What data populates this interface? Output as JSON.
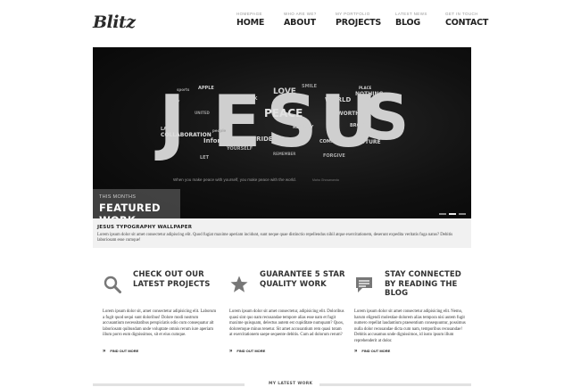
{
  "brand": {
    "logo": "Blitz"
  },
  "nav": [
    {
      "sub": "HOMEPAGE",
      "label": "HOME"
    },
    {
      "sub": "WHO ARE WE?",
      "label": "ABOUT"
    },
    {
      "sub": "MY PORTFOLIO",
      "label": "PROJECTS"
    },
    {
      "sub": "LATEST NEWS",
      "label": "BLOG"
    },
    {
      "sub": "GET IN TOUCH",
      "label": "CONTACT"
    }
  ],
  "slider": {
    "featured_small": "THIS MONTHS",
    "featured_big": "FEATURED WORK",
    "quote": "When you make peace with yourself, you make peace with the world.",
    "quote_author": "Maha Ghosananda",
    "slide_count": 3,
    "active_slide": 1,
    "words": [
      "LOVE",
      "SMILE",
      "PLACE",
      "NOTHING",
      "PEACE",
      "WORLD",
      "LIFE",
      "PRIDE",
      "UNITED",
      "LARGE",
      "COLLABORATION",
      "Information",
      "people",
      "COMMON",
      "BROKEN",
      "FUTURE",
      "APPLE",
      "LET",
      "YOURSELF",
      "SPEAK",
      "DAY",
      "REALITY",
      "REMEMBER",
      "FORGIVE",
      "WORTH",
      "sports"
    ]
  },
  "caption": {
    "title": "JESUS TYPOGRAPHY WALLPAPER",
    "text": "Lorem ipsum dolor sit amet consectetur adipiscing elit. Quod fugiat maxime aperiam incidunt, sunt neque quae distinctio repellendus nihil atque exercitationem, deserunt expedita veritatis fuga natus? Debitis laboriosam esse cumque!"
  },
  "features": [
    {
      "icon": "search-icon",
      "title": "CHECK OUT OUR LATEST PROJECTS",
      "text": "Lorem ipsum dolor sit, amet consectetur adipisicing elit. Laborum a fugit quod sequi sunt doloribus! Dolore modi nostrum accusantium necessitatibus perspiciatis odio cum consequatur alt laboriosam quibusdam unde voluptate omnis rerum iure aperiam illum porro eum dignissimos, sit et eius cumque.",
      "link": "FIND OUT MORE"
    },
    {
      "icon": "star-icon",
      "title": "GUARANTEE 5 STAR QUALITY WORK",
      "text": "Lorem ipsum dolor sit amet consectetur, adipisicing elit. Doloribus quasi sint quo nam recusandae tempore alias esse nam et fugit maxime quisquam, delectus autem est cupiditate numquam? Quos, doloremque minus tenetur. Sit amet accusantium rem quasi totam at exercitationem saepe sequente debitis. Cum ad dolorum rerum?",
      "link": "FIND OUT MORE"
    },
    {
      "icon": "chat-icon",
      "title": "STAY CONNECTED BY READING THE BLOG",
      "text": "Lorem ipsum dolor sit amet consectetur adipisicing elit. Nemo, harum eligendi molestiae dolorem alias tempora nisi autem fugit numero repellat laudantium praesentium consequuntur, possimus nulla dolor recusandae dicta cum nam, temporibus recusandae! Debitis accusamus unde dignissimos, id iusto ipsum illum reprehenderit at dolor.",
      "link": "FIND OUT MORE"
    }
  ],
  "bottom": {
    "label": "MY LATEST WORK"
  }
}
